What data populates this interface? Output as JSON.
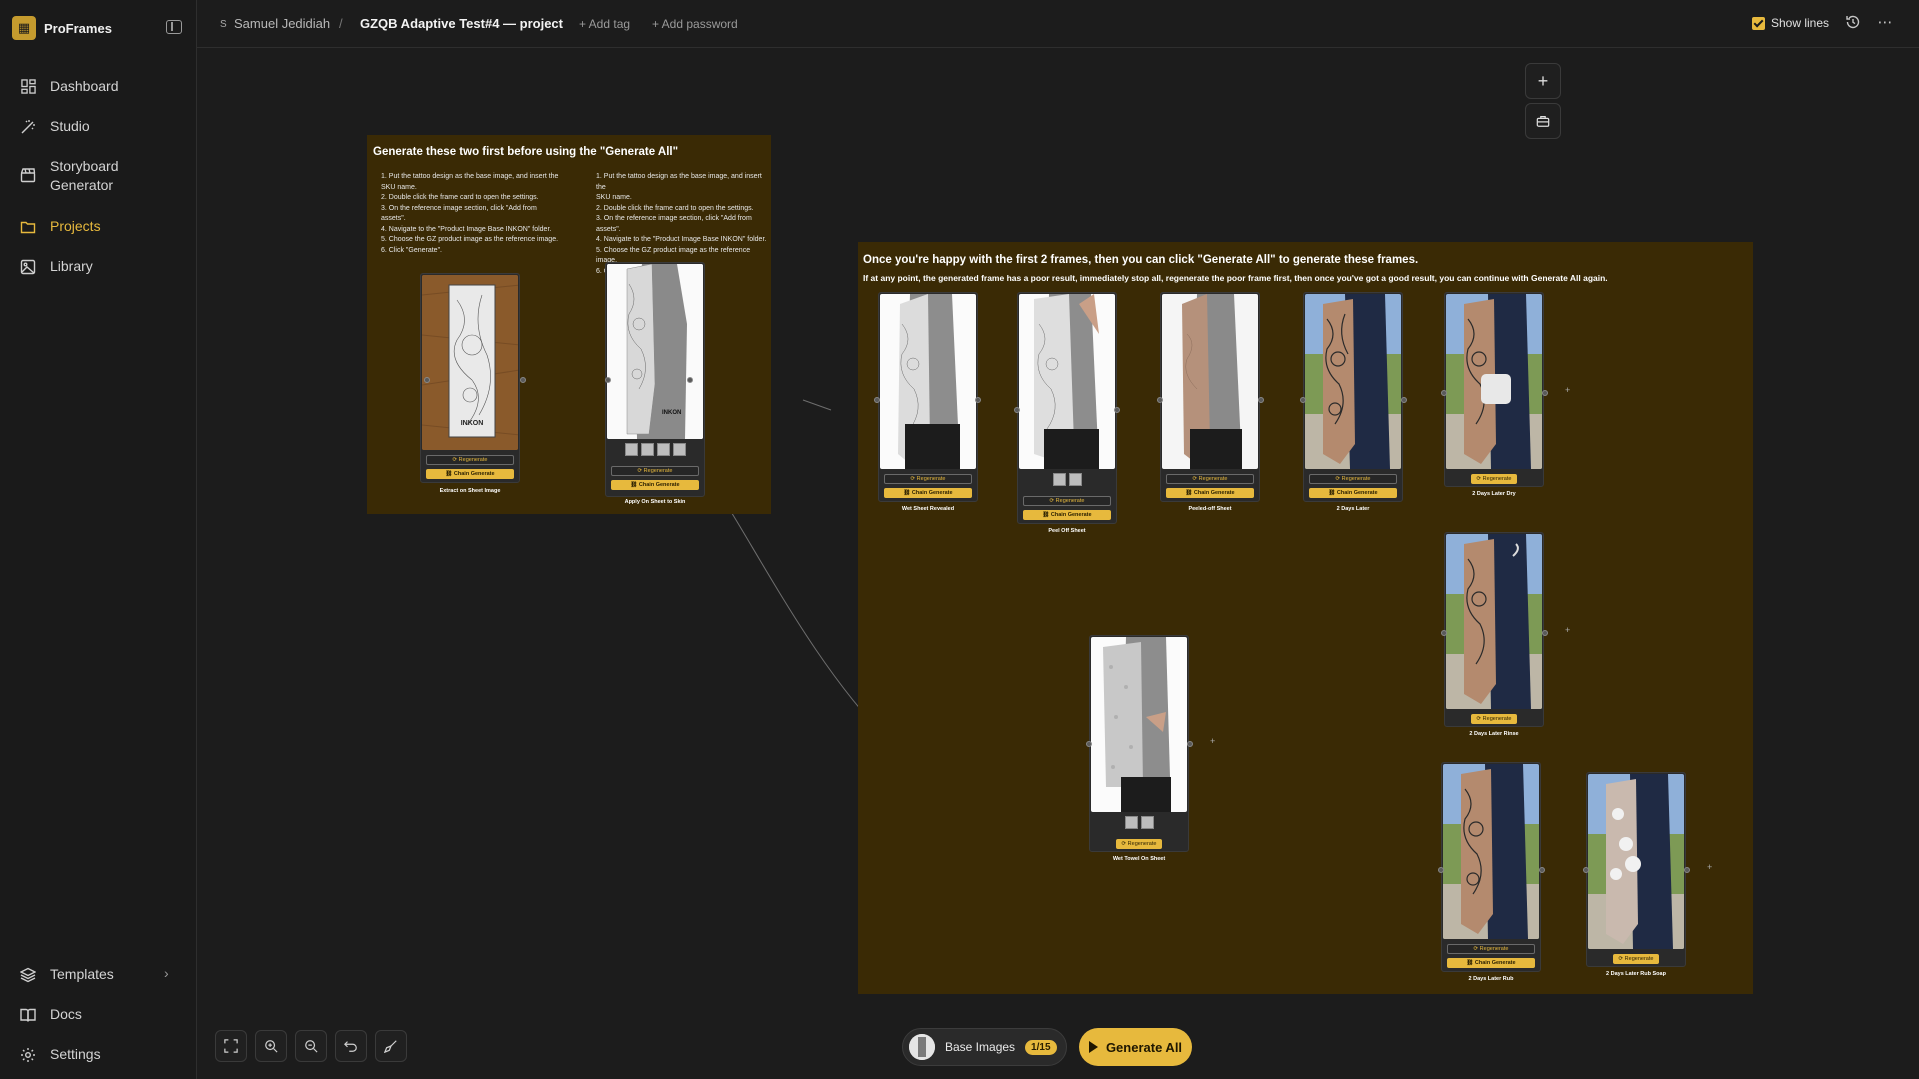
{
  "brand": {
    "name": "ProFrames"
  },
  "sidebar": {
    "items": [
      {
        "label": "Dashboard",
        "icon": "dashboard-icon"
      },
      {
        "label": "Studio",
        "icon": "wand-icon"
      },
      {
        "label": "Storyboard Generator",
        "line1": "Storyboard",
        "line2": "Generator",
        "icon": "clapperboard-icon"
      },
      {
        "label": "Projects",
        "icon": "folder-icon",
        "active": true
      },
      {
        "label": "Library",
        "icon": "image-icon"
      }
    ],
    "bottom": [
      {
        "label": "Templates",
        "icon": "layers-icon"
      },
      {
        "label": "Docs",
        "icon": "book-icon"
      },
      {
        "label": "Settings",
        "icon": "gear-icon"
      }
    ]
  },
  "topbar": {
    "user_initial": "S",
    "user": "Samuel Jedidiah",
    "sep": "/",
    "project": "GZQB Adaptive Test#4 — project",
    "add_tag": "+ Add tag",
    "add_password": "+ Add password",
    "show_lines": "Show lines",
    "show_lines_checked": true
  },
  "group1": {
    "title": "Generate these two first before using the \"Generate All\"",
    "steps_left": "1. Put the tattoo design as the base image, and insert the\nSKU name.\n2. Double click the frame card to open the settings.\n3. On the reference image section, click \"Add from\nassets\".\n4. Navigate to the \"Product Image Base INKON\" folder.\n5. Choose the GZ product image as the reference image.\n6. Click \"Generate\".",
    "steps_right": "1. Put the tattoo design as the base image, and insert the\nSKU name.\n2. Double click the frame card to open the settings.\n3. On the reference image section, click \"Add from\nassets\".\n4. Navigate to the \"Product Image Base INKON\" folder.\n5. Choose the GZ product image as the reference image.\n6. Click \"Generate\".",
    "frames": [
      {
        "label": "Extract on Sheet Image",
        "regen": "⟳ Regenerate",
        "chain": "⛓ Chain Generate",
        "image_text": "INKON"
      },
      {
        "label": "Apply On Sheet to Skin",
        "regen": "⟳ Regenerate",
        "chain": "⛓ Chain Generate",
        "image_text": "INKON"
      }
    ]
  },
  "group2": {
    "title": "Once you're happy with the first 2 frames, then you can click \"Generate All\" to generate these frames.",
    "subtitle": "If at any point, the generated frame has a poor result, immediately stop all, regenerate the poor frame first, then once you've got a good result, you can continue with Generate All again.",
    "frames": [
      {
        "label": "Wet Sheet Revealed",
        "regen": "⟳ Regenerate",
        "chain": "⛓ Chain Generate"
      },
      {
        "label": "Peel Off Sheet",
        "regen": "⟳ Regenerate",
        "chain": "⛓ Chain Generate"
      },
      {
        "label": "Peeled-off Sheet",
        "regen": "⟳ Regenerate",
        "chain": "⛓ Chain Generate"
      },
      {
        "label": "2 Days Later",
        "regen": "⟳ Regenerate",
        "chain": "⛓ Chain Generate"
      },
      {
        "label": "2 Days Later Dry",
        "regen": "⟳ Regenerate"
      },
      {
        "label": "2 Days Later Rinse",
        "regen": "⟳ Regenerate"
      },
      {
        "label": "Wet Towel On Sheet",
        "regen": "⟳ Regenerate"
      },
      {
        "label": "2 Days Later Rub",
        "regen": "⟳ Regenerate",
        "chain": "⛓ Chain Generate"
      },
      {
        "label": "2 Days Later Rub Soap",
        "regen": "⟳ Regenerate"
      }
    ]
  },
  "bottom_bar": {
    "base_images": "Base Images",
    "base_count": "1/15",
    "generate_all": "Generate All"
  },
  "colors": {
    "accent": "#e7b93d",
    "group_bg": "#3a2a05",
    "canvas_bg": "#1c1c1c"
  }
}
